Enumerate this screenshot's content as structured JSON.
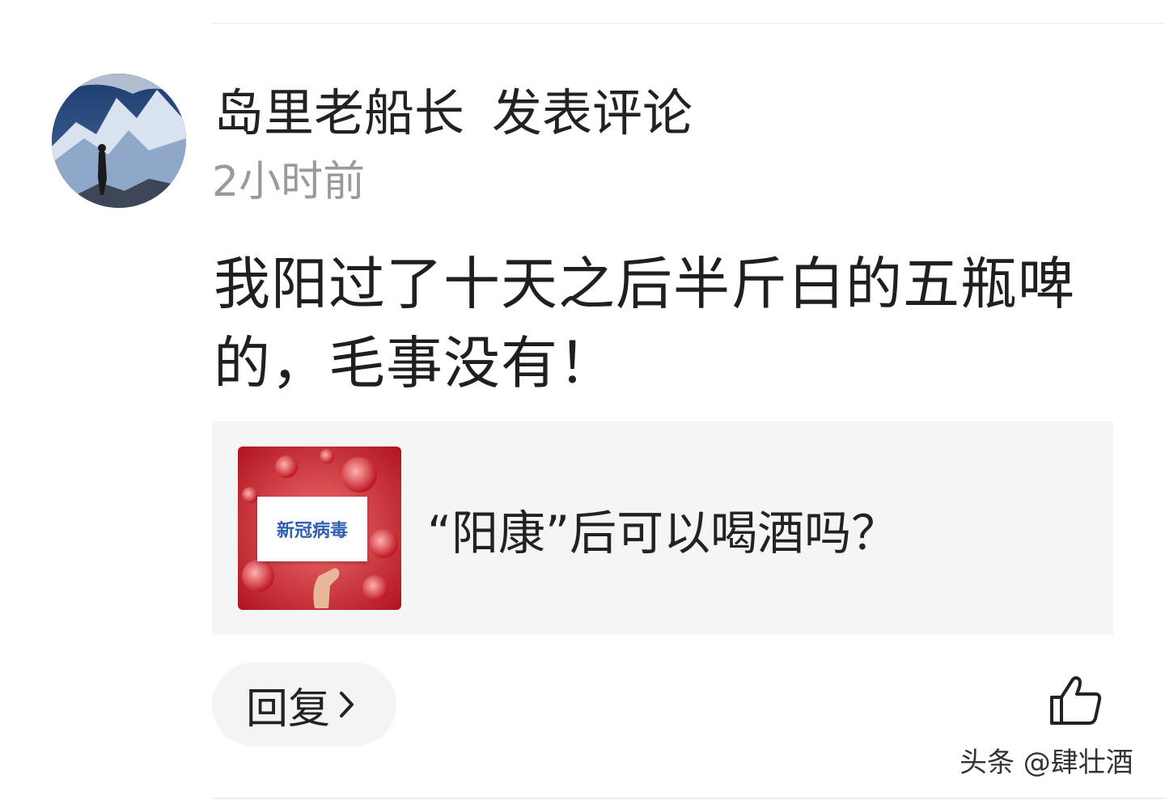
{
  "comment": {
    "author": "岛里老船长",
    "action": "发表评论",
    "time": "2小时前",
    "text": "我阳过了十天之后半斤白的五瓶啤的，毛事没有！"
  },
  "linked_article": {
    "thumbnail_text": "新冠病毒",
    "title": "“阳康”后可以喝酒吗？"
  },
  "actions": {
    "reply_label": "回复",
    "like_icon": "thumbs-up-icon"
  },
  "watermark": "头条 @肆壮酒",
  "colors": {
    "text": "#222222",
    "muted": "#9a9a9a",
    "card_bg": "#f5f5f5",
    "thumbnail_red": "#c81e2a",
    "thumbnail_text": "#2f5fb0"
  }
}
